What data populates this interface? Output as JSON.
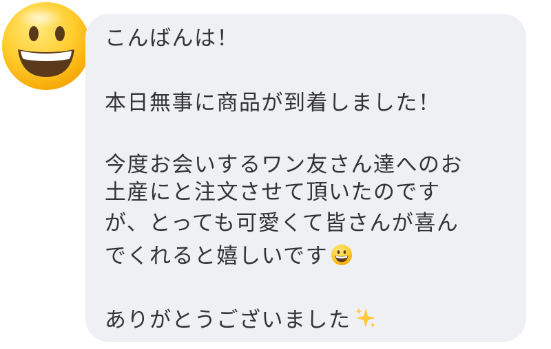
{
  "message": {
    "greeting": "こんばんは！",
    "arrival": "本日無事に商品が到着しました！",
    "body_line_1": "今度お会いするワン友さん達へのお",
    "body_line_2": "土産にと注文させて頂いたのです",
    "body_line_3": "が、とっても可愛くて皆さんが喜ん",
    "body_line_4": "でくれると嬉しいです",
    "thanks": "ありがとうございました"
  },
  "icons": {
    "avatar": "smiley-face-emoji",
    "body_emoji": "grinning-face-emoji",
    "thanks_emoji": "sparkles-emoji"
  },
  "colors": {
    "bubble_background": "#eff0f4",
    "text": "#333333",
    "emoji_yellow": "#ffc83d"
  }
}
